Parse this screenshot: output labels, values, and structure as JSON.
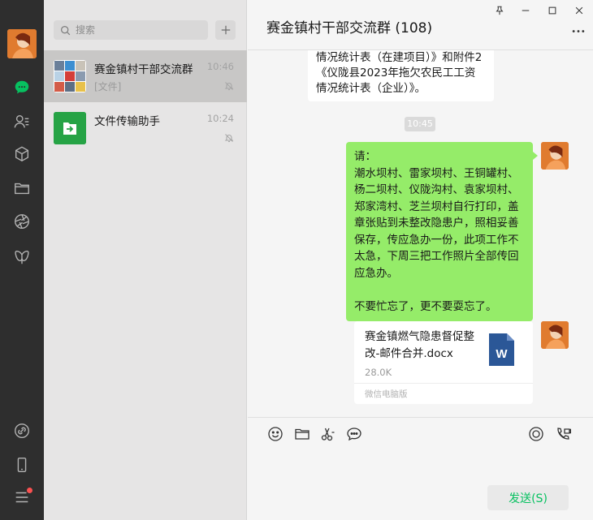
{
  "search": {
    "placeholder": "搜索"
  },
  "chats": [
    {
      "name": "赛金镇村干部交流群",
      "time": "10:46",
      "preview": "[文件]",
      "muted": true
    },
    {
      "name": "文件传输助手",
      "time": "10:24",
      "preview": "",
      "muted": true
    }
  ],
  "conversation": {
    "title": "赛金镇村干部交流群 (108)",
    "prev_message": "情况统计表（在建项目）》和附件2《仪陇县2023年拖欠农民工工资情况统计表（企业）》。",
    "time_chip": "10:45",
    "message_text": "请：\n潮水坝村、雷家坝村、王铜罐村、杨二坝村、仪陇沟村、袁家坝村、郑家湾村、芝兰坝村自行打印，盖章张贴到未整改隐患户，照相妥善保存，传应急办一份，此项工作不太急，下周三把工作照片全部传回应急办。\n\n不要忙忘了，更不要耍忘了。",
    "file": {
      "name": "赛金镇燃气隐患督促整改-邮件合并.docx",
      "size": "28.0K",
      "source": "微信电脑版",
      "icon_letter": "W"
    }
  },
  "input": {
    "send_label": "发送(S)"
  },
  "colors": {
    "rail": "#2e2e2e",
    "accent": "#07c160",
    "bubble_self": "#95ec69",
    "word_blue": "#2b5797"
  },
  "icons": {
    "rail": [
      "avatar",
      "chat-icon",
      "contacts-icon",
      "cube-icon",
      "folder-icon",
      "aperture-icon",
      "butterfly-icon",
      "link-icon",
      "phone-icon",
      "menu-icon"
    ],
    "toolbar": [
      "emoji-icon",
      "folder-icon",
      "scissors-icon",
      "speech-icon",
      "live-icon",
      "phone-video-icon"
    ]
  }
}
